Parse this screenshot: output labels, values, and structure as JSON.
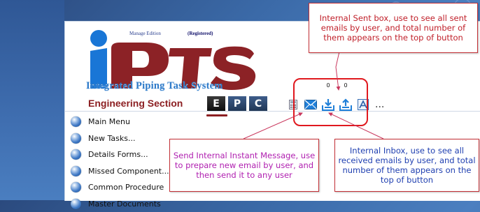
{
  "brand": {
    "edition": "Manage Edition",
    "registered": "(Registered)",
    "logo_text": "iPTS",
    "subtitle": "Integrated Piping Task System",
    "section_title": "Engineering Section"
  },
  "epc_buttons": [
    "E",
    "P",
    "C"
  ],
  "toolbar": {
    "inbox_count": "0",
    "sent_count": "0",
    "more": "..."
  },
  "menu": {
    "items": [
      {
        "label": "Main Menu"
      },
      {
        "label": "New Tasks..."
      },
      {
        "label": "Details Forms..."
      },
      {
        "label": "Missed Component..."
      },
      {
        "label": "Common Procedure"
      },
      {
        "label": "Master Documents"
      }
    ]
  },
  "callouts": {
    "sent": "Internal Sent box, use to see all sent emails by user, and total number of them appears on the top of button",
    "message": "Send Internal Instant Message, use to prepare new email by user, and then send it to any user",
    "inbox": "Internal Inbox, use to see all received emails by user, and total number of them appears on the top of button"
  },
  "colors": {
    "logo_blue": "#1976d6",
    "logo_red": "#8c2226",
    "callout_border": "#c32f35",
    "highlight": "#e0181e"
  }
}
